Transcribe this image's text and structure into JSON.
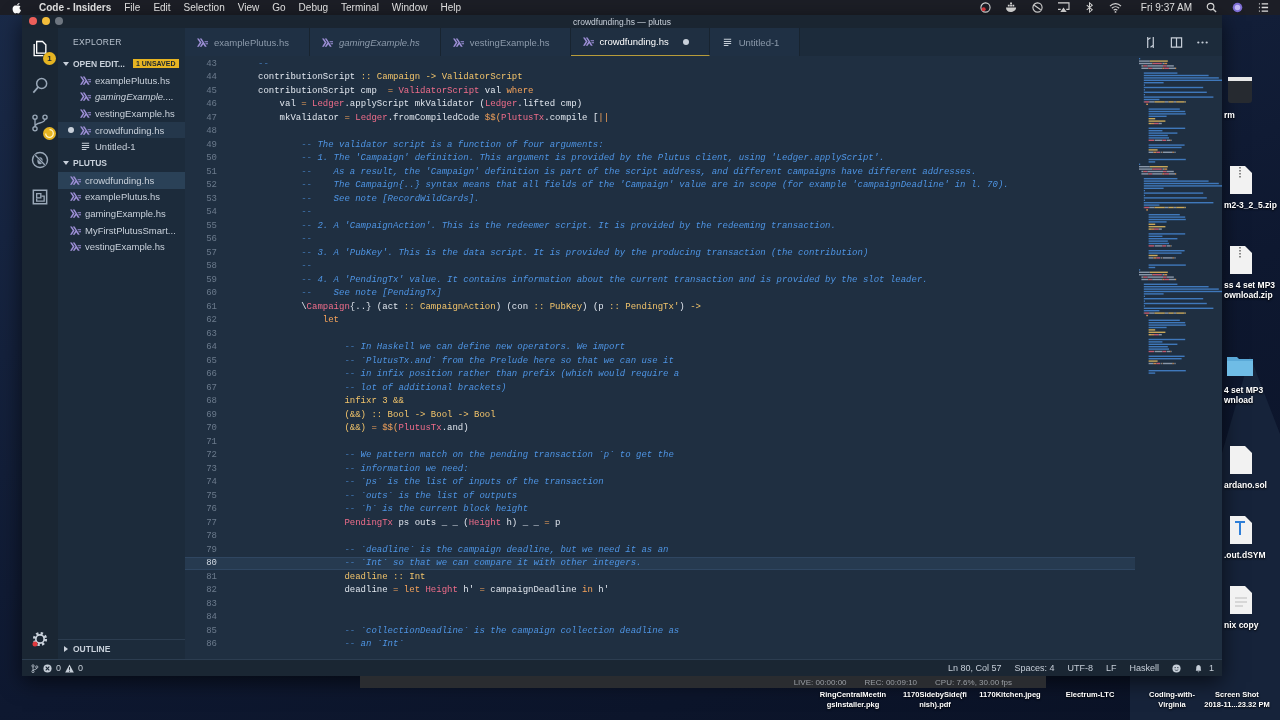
{
  "menubar": {
    "app": "Code - Insiders",
    "menus": [
      "File",
      "Edit",
      "Selection",
      "View",
      "Go",
      "Debug",
      "Terminal",
      "Window",
      "Help"
    ],
    "clock": "Fri 9:37 AM"
  },
  "window": {
    "title": "crowdfunding.hs — plutus"
  },
  "activity": {
    "files_badge": "1"
  },
  "sidebar": {
    "title": "EXPLORER",
    "open_editors": {
      "label": "OPEN EDIT...",
      "badge": "1 UNSAVED",
      "expanded": true,
      "items": [
        {
          "label": "examplePlutus.hs",
          "kind": "hs",
          "preview": false,
          "dirty": false,
          "selected": false
        },
        {
          "label": "gamingExample....",
          "kind": "hs",
          "preview": true,
          "dirty": false,
          "selected": false
        },
        {
          "label": "vestingExample.hs",
          "kind": "hs",
          "preview": false,
          "dirty": false,
          "selected": false
        },
        {
          "label": "crowdfunding.hs",
          "kind": "hs",
          "preview": false,
          "dirty": true,
          "selected": true
        },
        {
          "label": "Untitled-1",
          "kind": "txt",
          "preview": false,
          "dirty": false,
          "selected": false
        }
      ]
    },
    "folder": {
      "label": "PLUTUS",
      "expanded": true,
      "items": [
        {
          "label": "crowdfunding.hs",
          "selected": true
        },
        {
          "label": "examplePlutus.hs",
          "selected": false
        },
        {
          "label": "gamingExample.hs",
          "selected": false
        },
        {
          "label": "MyFirstPlutusSmart...",
          "selected": false
        },
        {
          "label": "vestingExample.hs",
          "selected": false
        }
      ]
    },
    "outline": {
      "label": "OUTLINE",
      "expanded": false
    }
  },
  "tabs": [
    {
      "label": "examplePlutus.hs",
      "kind": "hs",
      "preview": false,
      "dirty": false,
      "selected": false
    },
    {
      "label": "gamingExample.hs",
      "kind": "hs",
      "preview": true,
      "dirty": false,
      "selected": false
    },
    {
      "label": "vestingExample.hs",
      "kind": "hs",
      "preview": false,
      "dirty": false,
      "selected": false
    },
    {
      "label": "crowdfunding.hs",
      "kind": "hs",
      "preview": false,
      "dirty": true,
      "selected": true
    },
    {
      "label": "Untitled-1",
      "kind": "txt",
      "preview": false,
      "dirty": false,
      "selected": false
    }
  ],
  "code": [
    {
      "n": "43",
      "current": false,
      "tokens": [
        {
          "text": "--",
          "kind": "comment"
        }
      ]
    },
    {
      "n": "44",
      "current": false,
      "tokens": [
        {
          "text": "contributionScript ",
          "kind": "plain"
        },
        {
          "text": ":: Campaign -> ValidatorScript",
          "kind": "type"
        }
      ]
    },
    {
      "n": "45",
      "current": false,
      "tokens": [
        {
          "text": "contributionScript cmp  ",
          "kind": "plain"
        },
        {
          "text": "= ",
          "kind": "keyword"
        },
        {
          "text": "ValidatorScript",
          "kind": "constructor"
        },
        {
          "text": " val ",
          "kind": "plain"
        },
        {
          "text": "where",
          "kind": "keyword"
        }
      ]
    },
    {
      "n": "46",
      "current": false,
      "tokens": [
        {
          "text": "    val ",
          "kind": "plain"
        },
        {
          "text": "= ",
          "kind": "keyword"
        },
        {
          "text": "Ledger",
          "kind": "constructor"
        },
        {
          "text": ".applyScript mkValidator (",
          "kind": "plain"
        },
        {
          "text": "Ledger",
          "kind": "constructor"
        },
        {
          "text": ".lifted cmp)",
          "kind": "plain"
        }
      ]
    },
    {
      "n": "47",
      "current": false,
      "tokens": [
        {
          "text": "    mkValidator ",
          "kind": "plain"
        },
        {
          "text": "= ",
          "kind": "keyword"
        },
        {
          "text": "Ledger",
          "kind": "constructor"
        },
        {
          "text": ".fromCompiledCode ",
          "kind": "plain"
        },
        {
          "text": "$$(",
          "kind": "keyword"
        },
        {
          "text": "PlutusTx",
          "kind": "constructor"
        },
        {
          "text": ".compile [",
          "kind": "plain"
        },
        {
          "text": "||",
          "kind": "keyword"
        }
      ]
    },
    {
      "n": "48",
      "current": false
    },
    {
      "n": "49",
      "current": false,
      "tokens": [
        {
          "text": "        -- The validator script is a function of four arguments:",
          "kind": "comment"
        }
      ]
    },
    {
      "n": "50",
      "current": false,
      "tokens": [
        {
          "text": "        -- 1. The 'Campaign' definition. This argument is provided by the Plutus client, using 'Ledger.applyScript'.",
          "kind": "comment"
        }
      ]
    },
    {
      "n": "51",
      "current": false,
      "tokens": [
        {
          "text": "        --    As a result, the 'Campaign' definition is part of the script address, and different campaigns have different addresses.",
          "kind": "comment"
        }
      ]
    },
    {
      "n": "52",
      "current": false,
      "tokens": [
        {
          "text": "        --    The Campaign{..} syntax means that all fields of the 'Campaign' value are in scope (for example 'campaignDeadline' in l. 70).",
          "kind": "comment"
        }
      ]
    },
    {
      "n": "53",
      "current": false,
      "tokens": [
        {
          "text": "        --    See note [RecordWildCards].",
          "kind": "comment"
        }
      ]
    },
    {
      "n": "54",
      "current": false,
      "tokens": [
        {
          "text": "        --",
          "kind": "comment"
        }
      ]
    },
    {
      "n": "55",
      "current": false,
      "tokens": [
        {
          "text": "        -- 2. A 'CampaignAction'. This is the redeemer script. It is provided by the redeeming transaction.",
          "kind": "comment"
        }
      ]
    },
    {
      "n": "56",
      "current": false,
      "tokens": [
        {
          "text": "        --",
          "kind": "comment"
        }
      ]
    },
    {
      "n": "57",
      "current": false,
      "tokens": [
        {
          "text": "        -- 3. A 'PubKey'. This is the data script. It is provided by the producing transaction (the contribution)",
          "kind": "comment"
        }
      ]
    },
    {
      "n": "58",
      "current": false,
      "tokens": [
        {
          "text": "        --",
          "kind": "comment"
        }
      ]
    },
    {
      "n": "59",
      "current": false,
      "tokens": [
        {
          "text": "        -- 4. A 'PendingTx' value. It contains information about the current transaction and is provided by the slot leader.",
          "kind": "comment"
        }
      ]
    },
    {
      "n": "60",
      "current": false,
      "tokens": [
        {
          "text": "        --    See note [PendingTx]",
          "kind": "comment"
        }
      ]
    },
    {
      "n": "61",
      "current": false,
      "tokens": [
        {
          "text": "        \\",
          "kind": "plain"
        },
        {
          "text": "Campaign",
          "kind": "constructor"
        },
        {
          "text": "{..} (act ",
          "kind": "plain"
        },
        {
          "text": ":: CampaignAction",
          "kind": "type"
        },
        {
          "text": ") (con ",
          "kind": "plain"
        },
        {
          "text": ":: PubKey",
          "kind": "type"
        },
        {
          "text": ") (p ",
          "kind": "plain"
        },
        {
          "text": ":: PendingTx'",
          "kind": "type"
        },
        {
          "text": ") ",
          "kind": "plain"
        },
        {
          "text": "->",
          "kind": "type"
        }
      ]
    },
    {
      "n": "62",
      "current": false,
      "tokens": [
        {
          "text": "            let",
          "kind": "keyword"
        }
      ]
    },
    {
      "n": "63",
      "current": false
    },
    {
      "n": "64",
      "current": false,
      "tokens": [
        {
          "text": "                -- In Haskell we can define new operators. We import",
          "kind": "comment"
        }
      ]
    },
    {
      "n": "65",
      "current": false,
      "tokens": [
        {
          "text": "                -- `PlutusTx.and` from the Prelude here so that we can use it",
          "kind": "comment"
        }
      ]
    },
    {
      "n": "66",
      "current": false,
      "tokens": [
        {
          "text": "                -- in infix position rather than prefix (which would require a",
          "kind": "comment"
        }
      ]
    },
    {
      "n": "67",
      "current": false,
      "tokens": [
        {
          "text": "                -- lot of additional brackets)",
          "kind": "comment"
        }
      ]
    },
    {
      "n": "68",
      "current": false,
      "tokens": [
        {
          "text": "                infixr 3 &&",
          "kind": "type"
        }
      ]
    },
    {
      "n": "69",
      "current": false,
      "tokens": [
        {
          "text": "                (&&) :: Bool -> Bool -> Bool",
          "kind": "type"
        }
      ]
    },
    {
      "n": "70",
      "current": false,
      "tokens": [
        {
          "text": "                (&&) ",
          "kind": "type"
        },
        {
          "text": "= $$(",
          "kind": "keyword"
        },
        {
          "text": "PlutusTx",
          "kind": "constructor"
        },
        {
          "text": ".and)",
          "kind": "plain"
        }
      ]
    },
    {
      "n": "71",
      "current": false
    },
    {
      "n": "72",
      "current": false,
      "tokens": [
        {
          "text": "                -- We pattern match on the pending transaction `p` to get the",
          "kind": "comment"
        }
      ]
    },
    {
      "n": "73",
      "current": false,
      "tokens": [
        {
          "text": "                -- information we need:",
          "kind": "comment"
        }
      ]
    },
    {
      "n": "74",
      "current": false,
      "tokens": [
        {
          "text": "                -- `ps` is the list of inputs of the transaction",
          "kind": "comment"
        }
      ]
    },
    {
      "n": "75",
      "current": false,
      "tokens": [
        {
          "text": "                -- `outs` is the list of outputs",
          "kind": "comment"
        }
      ]
    },
    {
      "n": "76",
      "current": false,
      "tokens": [
        {
          "text": "                -- `h` is the current block height",
          "kind": "comment"
        }
      ]
    },
    {
      "n": "77",
      "current": false,
      "tokens": [
        {
          "text": "                PendingTx",
          "kind": "constructor"
        },
        {
          "text": " ps outs _ _ (",
          "kind": "plain"
        },
        {
          "text": "Height",
          "kind": "constructor"
        },
        {
          "text": " h) _ _ ",
          "kind": "plain"
        },
        {
          "text": "=",
          "kind": "keyword"
        },
        {
          "text": " p",
          "kind": "plain"
        }
      ]
    },
    {
      "n": "78",
      "current": false
    },
    {
      "n": "79",
      "current": false,
      "tokens": [
        {
          "text": "                -- `deadline` is the campaign deadline, but we need it as an",
          "kind": "comment"
        }
      ]
    },
    {
      "n": "80",
      "current": true,
      "tokens": [
        {
          "text": "                -- `Int` so that we can compare it with other integers.",
          "kind": "comment"
        }
      ]
    },
    {
      "n": "81",
      "current": false,
      "tokens": [
        {
          "text": "                deadline :: Int",
          "kind": "type"
        }
      ]
    },
    {
      "n": "82",
      "current": false,
      "tokens": [
        {
          "text": "                deadline ",
          "kind": "plain"
        },
        {
          "text": "= let ",
          "kind": "keyword"
        },
        {
          "text": "Height",
          "kind": "constructor"
        },
        {
          "text": " h' ",
          "kind": "plain"
        },
        {
          "text": "=",
          "kind": "keyword"
        },
        {
          "text": " campaignDeadline ",
          "kind": "plain"
        },
        {
          "text": "in",
          "kind": "keyword"
        },
        {
          "text": " h'",
          "kind": "plain"
        }
      ]
    },
    {
      "n": "83",
      "current": false
    },
    {
      "n": "84",
      "current": false
    },
    {
      "n": "85",
      "current": false,
      "tokens": [
        {
          "text": "                -- `collectionDeadline` is the campaign collection deadline as",
          "kind": "comment"
        }
      ]
    },
    {
      "n": "86",
      "current": false,
      "tokens": [
        {
          "text": "                -- an `Int`",
          "kind": "comment"
        }
      ]
    }
  ],
  "status": {
    "errors": "0",
    "warnings": "0",
    "position": "Ln 80, Col 57",
    "spaces": "Spaces: 4",
    "encoding": "UTF-8",
    "eol": "LF",
    "language": "Haskell",
    "notifications": "1"
  },
  "recorder": {
    "live": "LIVE: 00:00:00",
    "rec": "REC: 00:09:10",
    "cpu": "CPU: 7.6%, 30.00 fps"
  },
  "desktop_side": [
    {
      "kind": "app",
      "lines": [
        "rm"
      ]
    },
    {
      "kind": "zip",
      "lines": [
        "m2-3_2_5.zip"
      ]
    },
    {
      "kind": "zip",
      "lines": [
        "ss 4 set MP3",
        "ownload.zip"
      ]
    },
    {
      "kind": "folder",
      "lines": [
        "4 set MP3",
        "wnload"
      ]
    },
    {
      "kind": "doc",
      "lines": [
        "ardano.sol"
      ]
    },
    {
      "kind": "dsym",
      "lines": [
        ".out.dSYM"
      ]
    },
    {
      "kind": "txt",
      "lines": [
        "nix copy"
      ]
    }
  ],
  "desktop_bottom": [
    {
      "lines": [
        "RingCentralMeetin",
        "gsInstaller.pkg"
      ]
    },
    {
      "lines": [
        "1170SidebySide(fi",
        "nish).pdf"
      ]
    },
    {
      "lines": [
        "1170Kitchen.jpeg"
      ]
    },
    {
      "lines": [
        "Electrum-LTC"
      ]
    },
    {
      "lines": [
        "Coding-with-",
        "Virginia"
      ]
    },
    {
      "lines": [
        "Screen Shot",
        "2018-11...23.32 PM"
      ]
    }
  ]
}
